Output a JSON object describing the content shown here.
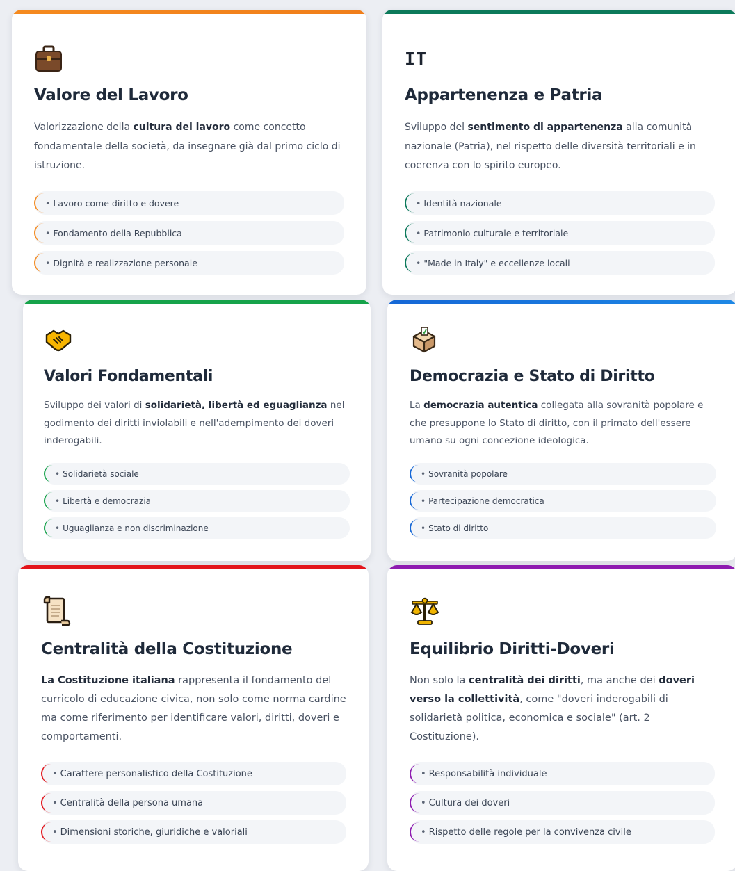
{
  "cards": [
    {
      "id": "valore-del-lavoro",
      "accent": "#f58a1f",
      "icon": "briefcase-icon",
      "title": "Valore del Lavoro",
      "desc": [
        {
          "t": "Valorizzazione della ",
          "b": false
        },
        {
          "t": "cultura del lavoro",
          "b": true
        },
        {
          "t": " come concetto fondamentale della società, da insegnare già dal primo ciclo di istruzione.",
          "b": false
        }
      ],
      "items": [
        "Lavoro come diritto e dovere",
        "Fondamento della Repubblica",
        "Dignità e realizzazione personale"
      ]
    },
    {
      "id": "appartenenza-e-patria",
      "accent": "#0c7a5a",
      "icon": "it-flag-icon",
      "icon_text": "IT",
      "title": "Appartenenza e Patria",
      "desc": [
        {
          "t": "Sviluppo del ",
          "b": false
        },
        {
          "t": "sentimento di appartenenza",
          "b": true
        },
        {
          "t": " alla comunità nazionale (Patria), nel rispetto delle diversità territoriali e in coerenza con lo spirito europeo.",
          "b": false
        }
      ],
      "items": [
        "Identità nazionale",
        "Patrimonio culturale e territoriale",
        "\"Made in Italy\" e eccellenze locali"
      ]
    },
    {
      "id": "valori-fondamentali",
      "accent": "#16a34a",
      "icon": "handshake-icon",
      "title": "Valori Fondamentali",
      "desc": [
        {
          "t": "Sviluppo dei valori di ",
          "b": false
        },
        {
          "t": "solidarietà, libertà ed eguaglianza",
          "b": true
        },
        {
          "t": " nel godimento dei diritti inviolabili e nell'adempimento dei doveri inderogabili.",
          "b": false
        }
      ],
      "items": [
        "Solidarietà sociale",
        "Libertà e democrazia",
        "Uguaglianza e non discriminazione"
      ]
    },
    {
      "id": "democrazia-stato-di-diritto",
      "accent": "#1567d6",
      "icon": "ballot-box-icon",
      "title": "Democrazia e Stato di Diritto",
      "desc": [
        {
          "t": "La ",
          "b": false
        },
        {
          "t": "democrazia autentica",
          "b": true
        },
        {
          "t": " collegata alla sovranità popolare e che presuppone lo Stato di diritto, con il primato dell'essere umano su ogni concezione ideologica.",
          "b": false
        }
      ],
      "items": [
        "Sovranità popolare",
        "Partecipazione democratica",
        "Stato di diritto"
      ]
    },
    {
      "id": "centralita-costituzione",
      "accent": "#e3141b",
      "icon": "scroll-icon",
      "title": "Centralità della Costituzione",
      "desc": [
        {
          "t": "La Costituzione italiana",
          "b": true
        },
        {
          "t": " rappresenta il fondamento del curricolo di educazione civica, non solo come norma cardine ma come riferimento per identificare valori, diritti, doveri e comportamenti.",
          "b": false
        }
      ],
      "items": [
        "Carattere personalistico della Costituzione",
        "Centralità della persona umana",
        "Dimensioni storiche, giuridiche e valoriali"
      ]
    },
    {
      "id": "equilibrio-diritti-doveri",
      "accent": "#8e1bb0",
      "icon": "balance-scale-icon",
      "title": "Equilibrio Diritti-Doveri",
      "desc": [
        {
          "t": "Non solo la ",
          "b": false
        },
        {
          "t": "centralità dei diritti",
          "b": true
        },
        {
          "t": ", ma anche dei ",
          "b": false
        },
        {
          "t": "doveri verso la collettività",
          "b": true
        },
        {
          "t": ", come \"doveri inderogabili di solidarietà politica, economica e sociale\" (art. 2 Costituzione).",
          "b": false
        }
      ],
      "items": [
        "Responsabilità individuale",
        "Cultura dei doveri",
        "Rispetto delle regole per la convivenza civile"
      ]
    }
  ]
}
